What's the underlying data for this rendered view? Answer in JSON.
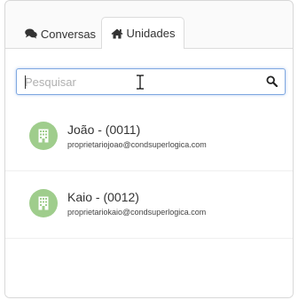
{
  "tabs": [
    {
      "label": "Conversas",
      "icon": "comments-icon",
      "active": false
    },
    {
      "label": "Unidades",
      "icon": "home-icon",
      "active": true
    }
  ],
  "search": {
    "placeholder": "Pesquisar",
    "value": "",
    "icon": "search-icon"
  },
  "units": [
    {
      "name": "João - (0011)",
      "email": "proprietariojoao@condsuperlogica.com",
      "icon": "building-icon"
    },
    {
      "name": "Kaio - (0012)",
      "email": "proprietariokaio@condsuperlogica.com",
      "icon": "building-icon"
    }
  ],
  "colors": {
    "avatar_bg": "#9fcd8c",
    "focus_border": "#7fa8e0"
  }
}
